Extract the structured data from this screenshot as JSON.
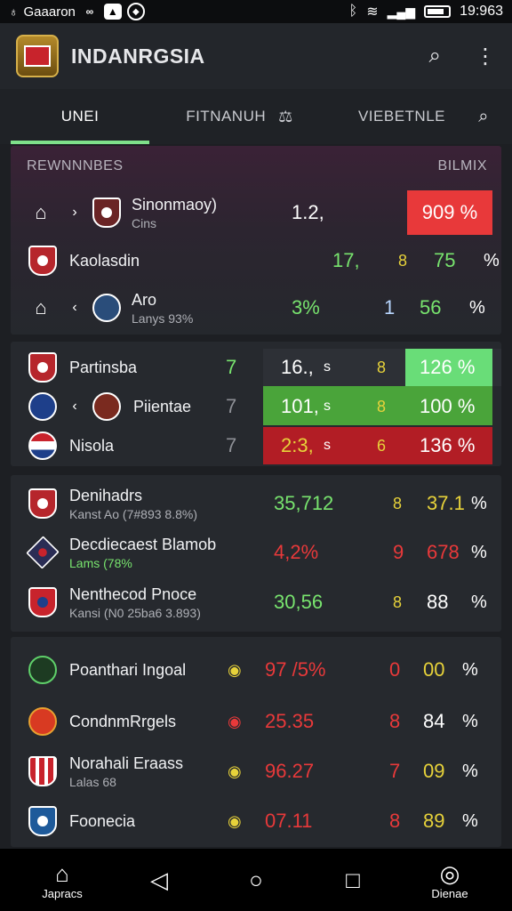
{
  "status": {
    "left_text": "Gaaaron",
    "time": "19:963"
  },
  "app": {
    "title": "INDANRGSIA"
  },
  "tabs": [
    {
      "label": "UNEI"
    },
    {
      "label": "FITNANUH"
    },
    {
      "label": "VIEBETNLE"
    }
  ],
  "card1": {
    "head_left": "REWNNNBES",
    "head_right": "BILMIX",
    "rows": [
      {
        "name": "Sinonmaoy)",
        "sub": "Cins",
        "value": "1.2,",
        "pct": "909 %"
      },
      {
        "name": "Kaolasdin",
        "value": "17,",
        "mark": "8",
        "num": "75",
        "pct": "%"
      },
      {
        "name": "Aro",
        "sub": "Lanys 93%",
        "value": "3%",
        "mark": "1",
        "num": "56",
        "pct": "%"
      }
    ]
  },
  "card2": {
    "rows": [
      {
        "name": "Partinsba",
        "n": "7",
        "value": "16.,",
        "unit": "s",
        "mark": "8",
        "pct": "126 %"
      },
      {
        "name": "Piientae",
        "n": "7",
        "value": "101,",
        "unit": "s",
        "mark": "8",
        "pct": "100 %"
      },
      {
        "name": "Nisola",
        "n": "7",
        "value": "2:3,",
        "unit": "s",
        "mark": "6",
        "pct": "136 %"
      }
    ]
  },
  "card3": {
    "rows": [
      {
        "name": "Denihadrs",
        "sub": "Kanst Ao (7#893 8.8%)",
        "value": "35,712",
        "mark": "8",
        "num": "37.1",
        "pct": "%"
      },
      {
        "name": "Decdiecaest Blamob",
        "sub": "Lams (78%",
        "value": "4,2%",
        "mark": "9",
        "num": "678",
        "pct": "%"
      },
      {
        "name": "Nenthecod Pnoce",
        "sub": "Kansi (N0 25ba6 3.893)",
        "value": "30,56",
        "mark": "8",
        "num": "88",
        "pct": "%"
      }
    ]
  },
  "card4": {
    "rows": [
      {
        "name": "Poanthari Ingoal",
        "value": "97 /5%",
        "mark": "0",
        "num": "00",
        "pct": "%"
      },
      {
        "name": "CondnmRrgels",
        "value": "25.35",
        "mark": "8",
        "num": "84",
        "pct": "%"
      },
      {
        "name": "Norahali Eraass",
        "sub": "Lalas 68",
        "value": "96.27",
        "mark": "7",
        "num": "09",
        "pct": "%"
      },
      {
        "name": "Foonecia",
        "value": "07.11",
        "mark": "8",
        "num": "89",
        "pct": "%"
      }
    ]
  },
  "nav": {
    "left_label": "Japracs",
    "right_label": "Dienae"
  }
}
